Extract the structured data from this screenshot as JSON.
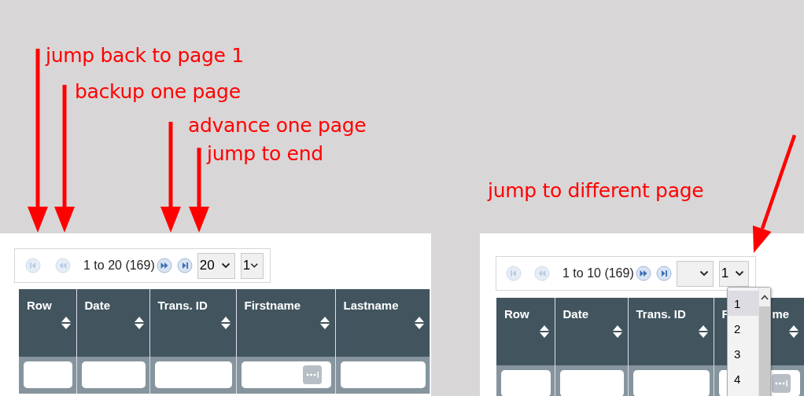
{
  "annotations": [
    {
      "text": "jump back to page 1"
    },
    {
      "text": "backup one page"
    },
    {
      "text": "advance one page"
    },
    {
      "text": "jump to end"
    },
    {
      "text": "jump to different page"
    }
  ],
  "panels": [
    {
      "pager": {
        "buttons": [
          {
            "kind": "first",
            "disabled": true
          },
          {
            "kind": "prev",
            "disabled": true
          }
        ],
        "range": "1 to 20 (169)",
        "buttons_after": [
          {
            "kind": "next",
            "disabled": false
          },
          {
            "kind": "last",
            "disabled": false
          }
        ],
        "page_size": "20",
        "page": "1"
      },
      "columns": [
        {
          "label_parts": [
            "Row"
          ],
          "has_menu": false
        },
        {
          "label_parts": [
            "Date"
          ],
          "has_menu": false
        },
        {
          "label_parts": [
            "Trans. ID"
          ],
          "has_menu": false
        },
        {
          "label_parts": [
            "Firstname"
          ],
          "has_menu": true
        },
        {
          "label_parts": [
            "Lastname"
          ],
          "has_menu": false
        }
      ]
    },
    {
      "pager": {
        "buttons": [
          {
            "kind": "first",
            "disabled": true
          },
          {
            "kind": "prev",
            "disabled": true
          }
        ],
        "range": "1 to 10 (169)",
        "buttons_after": [
          {
            "kind": "next",
            "disabled": false
          },
          {
            "kind": "last",
            "disabled": false
          }
        ],
        "page": "1"
      },
      "columns": [
        {
          "label_parts": [
            "Row"
          ],
          "has_menu": false
        },
        {
          "label_parts": [
            "Date"
          ],
          "has_menu": false
        },
        {
          "label_parts": [
            "Trans. ID"
          ],
          "has_menu": false
        },
        {
          "label_parts": [
            "F",
            "me"
          ],
          "has_menu": true
        }
      ],
      "dropdown": {
        "options": [
          {
            "label": "1",
            "selected": true
          },
          {
            "label": "2",
            "selected": false
          },
          {
            "label": "3",
            "selected": false
          },
          {
            "label": "4",
            "selected": false
          }
        ]
      }
    }
  ]
}
